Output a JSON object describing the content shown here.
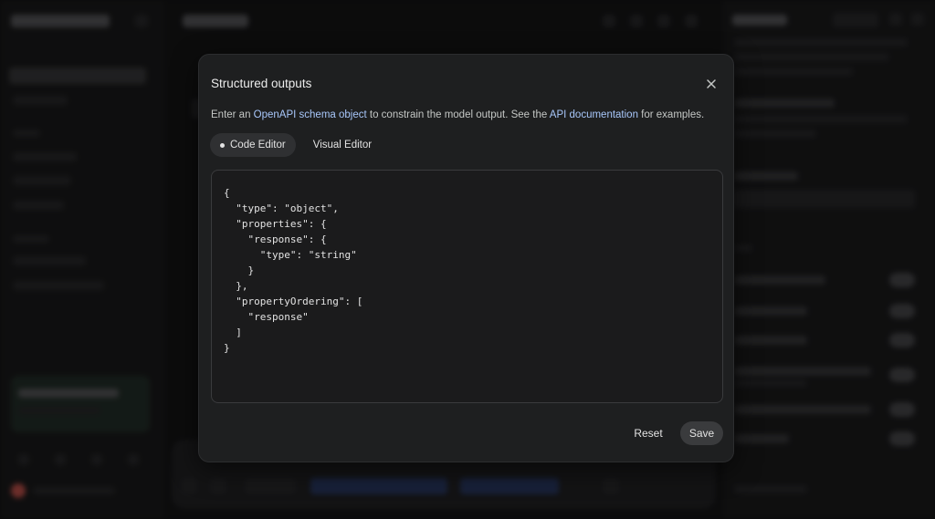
{
  "modal": {
    "title": "Structured outputs",
    "description": {
      "part1": "Enter an ",
      "link1": "OpenAPI schema object",
      "part2": " to constrain the model output. See the ",
      "link2": "API documentation",
      "part3": " for examples."
    },
    "tabs": [
      {
        "label": "Code Editor",
        "active": true
      },
      {
        "label": "Visual Editor",
        "active": false
      }
    ],
    "code_lines": [
      "{",
      "  \"type\": \"object\",",
      "  \"properties\": {",
      "    \"response\": {",
      "      \"type\": \"string\"",
      "    }",
      "  },",
      "  \"propertyOrdering\": [",
      "    \"response\"",
      "  ]",
      "}"
    ],
    "buttons": {
      "reset": "Reset",
      "save": "Save"
    },
    "close_icon": "close-icon"
  },
  "colors": {
    "accent_link": "#a8c7fa",
    "modal_bg": "#1e1f20",
    "page_bg": "#131314"
  }
}
